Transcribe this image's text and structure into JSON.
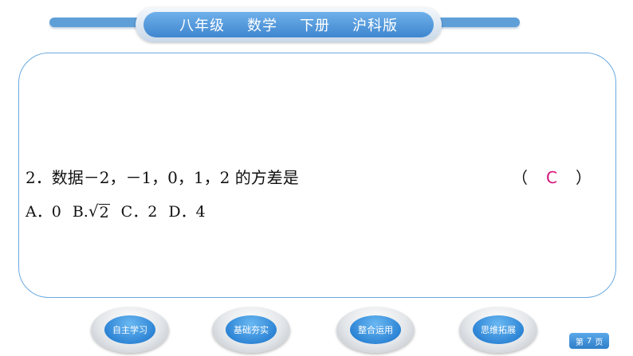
{
  "header": {
    "grade": "八年级",
    "subject": "数学",
    "volume": "下册",
    "edition": "沪科版"
  },
  "question": {
    "stem": "2．数据－2，－1，0，1，2 的方差是",
    "paren_open": "（",
    "answer": "C",
    "paren_close": "）",
    "options": {
      "a": "A．0",
      "b_prefix": "B.",
      "b_radicand": "2",
      "c": "C．2",
      "d": "D．4"
    }
  },
  "nav": {
    "items": [
      "自主学习",
      "基础夯实",
      "整合运用",
      "思维拓展"
    ]
  },
  "page_badge": {
    "prefix": "第",
    "number": "7",
    "suffix": "页"
  },
  "colors": {
    "accent_blue": "#3f86cf",
    "answer_magenta": "#d4127a"
  }
}
